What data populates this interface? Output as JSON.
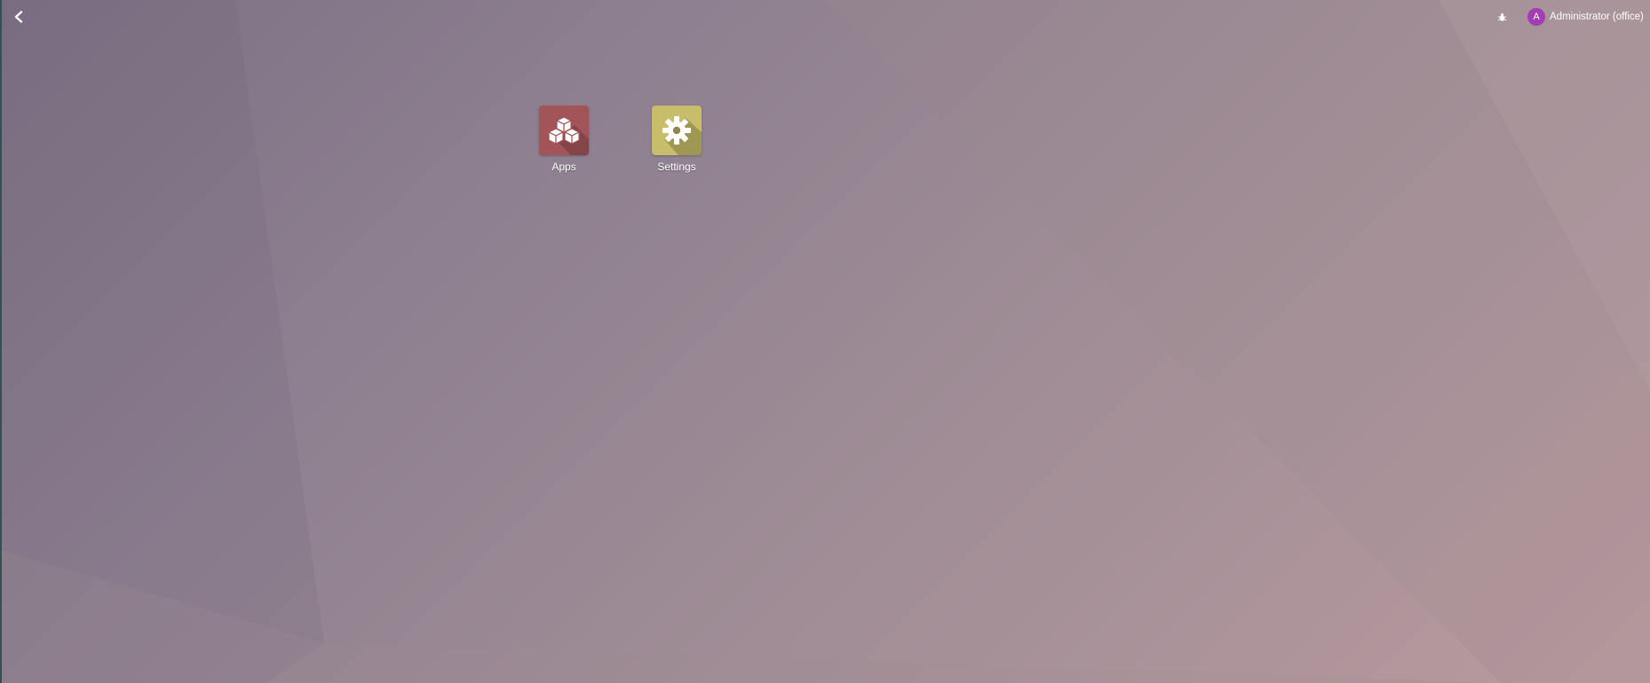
{
  "topbar": {
    "back_icon": "chevron-left-icon",
    "debug_icon": "bug-icon",
    "user": {
      "avatar_initial": "A",
      "avatar_color": "#a23db3",
      "name": "Administrator (office)"
    }
  },
  "apps": [
    {
      "label": "Apps",
      "icon": "cubes-icon",
      "color": "#a35458"
    },
    {
      "label": "Settings",
      "icon": "gear-icon",
      "color": "#c7bd6a"
    }
  ],
  "colors": {
    "background_start": "#7a6f82",
    "background_end": "#b89a9e"
  }
}
